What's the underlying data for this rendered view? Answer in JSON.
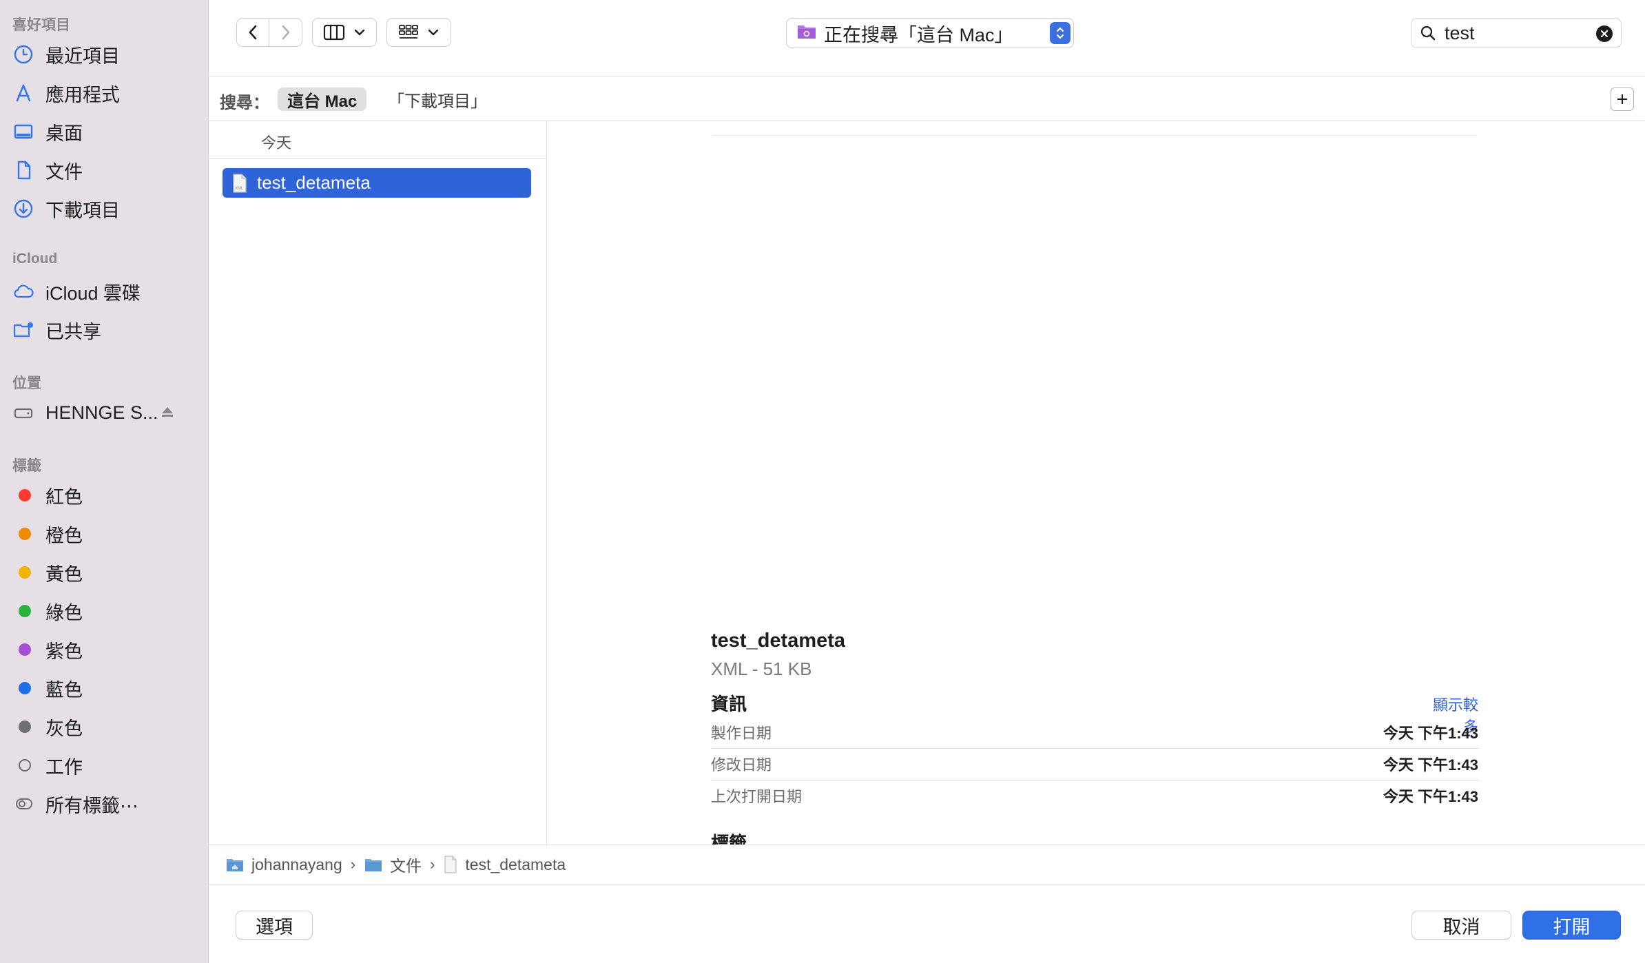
{
  "sidebar": {
    "favorites_title": "喜好項目",
    "favorites": [
      {
        "label": "最近項目",
        "icon": "clock-icon"
      },
      {
        "label": "應用程式",
        "icon": "apps-icon"
      },
      {
        "label": "桌面",
        "icon": "desktop-icon"
      },
      {
        "label": "文件",
        "icon": "document-icon"
      },
      {
        "label": "下載項目",
        "icon": "download-icon"
      }
    ],
    "icloud_title": "iCloud",
    "icloud": [
      {
        "label": "iCloud 雲碟",
        "icon": "cloud-icon"
      },
      {
        "label": "已共享",
        "icon": "shared-folder-icon"
      }
    ],
    "locations_title": "位置",
    "locations": [
      {
        "label": "HENNGE S...",
        "icon": "drive-icon"
      }
    ],
    "tags_title": "標籤",
    "tags": [
      {
        "label": "紅色",
        "color": "#ff3b30"
      },
      {
        "label": "橙色",
        "color": "#f08a00"
      },
      {
        "label": "黃色",
        "color": "#f2b400"
      },
      {
        "label": "綠色",
        "color": "#28b43c"
      },
      {
        "label": "紫色",
        "color": "#a550d0"
      },
      {
        "label": "藍色",
        "color": "#1f6fe8"
      },
      {
        "label": "灰色",
        "color": "#6e6e73"
      },
      {
        "label": "工作",
        "color": "none"
      },
      {
        "label": "所有標籤⋯",
        "color": "all"
      }
    ]
  },
  "toolbar": {
    "location_label": "正在搜尋「這台 Mac」",
    "search_value": "test"
  },
  "scopebar": {
    "label": "搜尋：",
    "options": [
      "這台 Mac",
      "「下載項目」"
    ]
  },
  "filelist": {
    "group_header": "今天",
    "selected_file": "test_detameta"
  },
  "preview": {
    "file_name": "test_detameta",
    "kind_size": "XML - 51 KB",
    "info_title": "資訊",
    "show_more": "顯示較多",
    "rows": [
      {
        "key": "製作日期",
        "value": "今天 下午1:43"
      },
      {
        "key": "修改日期",
        "value": "今天 下午1:43"
      },
      {
        "key": "上次打開日期",
        "value": "今天 下午1:43"
      }
    ],
    "tags_title": "標籤"
  },
  "pathbar": [
    "johannayang",
    "文件",
    "test_detameta"
  ],
  "buttons": {
    "options": "選項",
    "cancel": "取消",
    "open": "打開"
  },
  "colors": {
    "accent": "#2f63d8",
    "sidebar_bg": "#e6e0e6"
  }
}
